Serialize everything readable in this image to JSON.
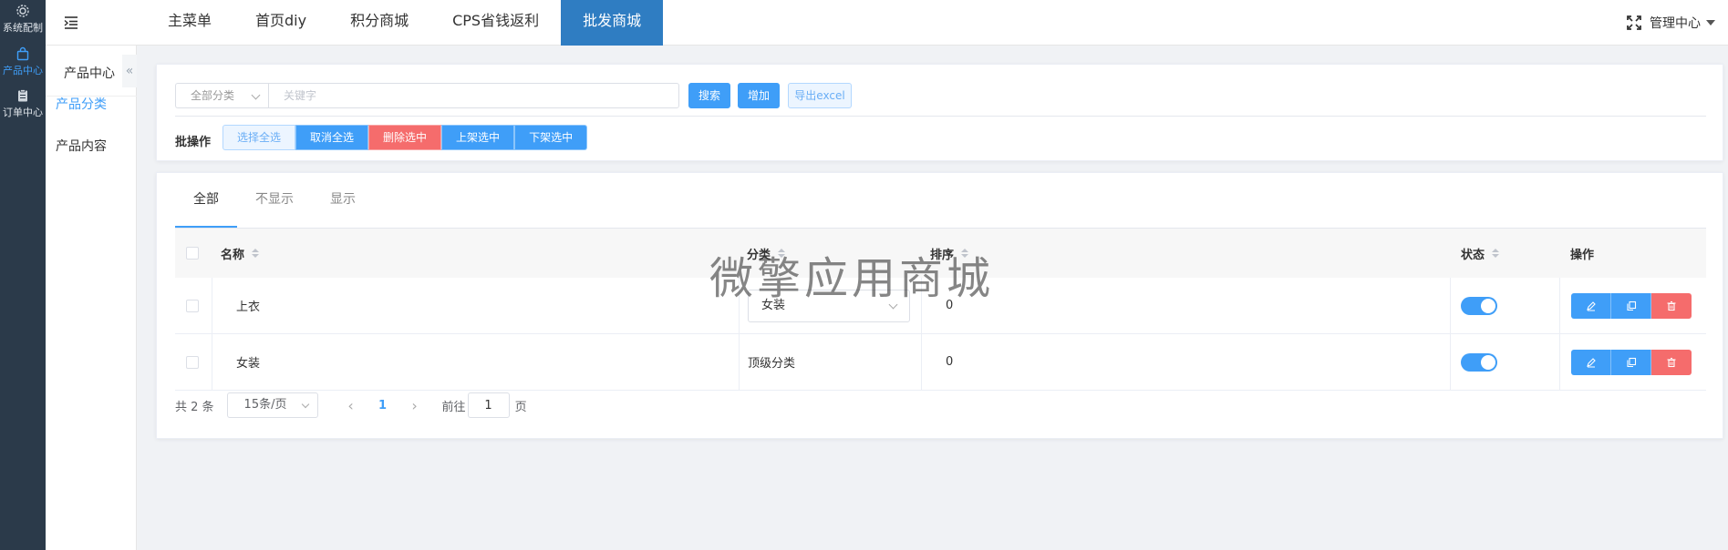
{
  "rail": {
    "items": [
      {
        "label": "系统配制",
        "icon": "gear-icon",
        "active": false
      },
      {
        "label": "产品中心",
        "icon": "bag-icon",
        "active": true
      },
      {
        "label": "订单中心",
        "icon": "clipboard-icon",
        "active": false
      }
    ]
  },
  "topnav": {
    "items": [
      "主菜单",
      "首页diy",
      "积分商城",
      "CPS省钱返利",
      "批发商城"
    ],
    "active": "批发商城",
    "admin_label": "管理中心"
  },
  "sidebar": {
    "title": "产品中心",
    "collapse": "«",
    "items": [
      {
        "label": "产品分类",
        "active": true
      },
      {
        "label": "产品内容",
        "active": false
      }
    ]
  },
  "filter": {
    "category_select": "全部分类",
    "keyword_placeholder": "关键字",
    "search_label": "搜索",
    "add_label": "增加",
    "export_label": "导出excel",
    "batch_label": "批操作",
    "batch_buttons": [
      "选择全选",
      "取消全选",
      "删除选中",
      "上架选中",
      "下架选中"
    ]
  },
  "tabs": [
    "全部",
    "不显示",
    "显示"
  ],
  "table": {
    "columns": {
      "name": "名称",
      "category": "分类",
      "sort": "排序",
      "status": "状态",
      "actions": "操作"
    },
    "rows": [
      {
        "name": "上衣",
        "category": "女装",
        "category_is_select": true,
        "sort": "0",
        "status_on": true
      },
      {
        "name": "女装",
        "category": "顶级分类",
        "category_is_select": false,
        "sort": "0",
        "status_on": true
      }
    ]
  },
  "pagination": {
    "total": "共 2 条",
    "page_size": "15条/页",
    "current_page": "1",
    "goto_label": "前往",
    "goto_value": "1",
    "page_suffix": "页"
  },
  "watermark": "微擎应用商城",
  "colors": {
    "primary": "#3f9ef8",
    "danger": "#f56c6c",
    "rail": "#2b3a4a",
    "active_nav": "#2f7dc2"
  }
}
